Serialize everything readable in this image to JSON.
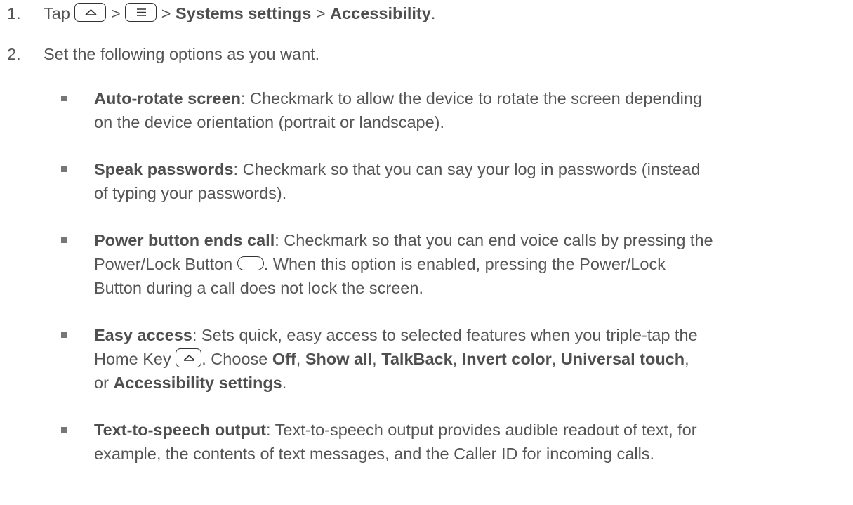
{
  "step1": {
    "num": "1.",
    "tap": "Tap",
    "sep1": ">",
    "sep2": ">",
    "path1": "Systems settings",
    "sep3": " > ",
    "path2": "Accessibility",
    "end": "."
  },
  "step2": {
    "num": "2.",
    "text": "Set the following options as you want."
  },
  "options": [
    {
      "title": "Auto-rotate screen",
      "lines": [
        ": Checkmark to allow the device to rotate the screen depending",
        "on the device orientation (portrait or landscape)."
      ]
    },
    {
      "title": "Speak passwords",
      "lines": [
        ": Checkmark so that you can say your log in passwords (instead",
        "of typing your passwords)."
      ]
    },
    {
      "title": "Power button ends call",
      "line1": ": Checkmark so that you can end voice calls by pressing the",
      "line2a": "Power/Lock Button",
      "line2b": ". When this option is enabled, pressing the Power/Lock",
      "line3": "Button during a call does not lock the screen."
    },
    {
      "title": "Easy access",
      "line1": ": Sets quick, easy access to selected features when you triple-tap the",
      "line2a": "Home Key",
      "line2b": ". Choose ",
      "choices": [
        "Off",
        "Show all",
        "TalkBack",
        "Invert color",
        "Universal touch"
      ],
      "comma": ", ",
      "line3a": "or ",
      "line3b": "Accessibility settings",
      "line3c": "."
    },
    {
      "title": "Text-to-speech output",
      "lines": [
        ": Text-to-speech output provides audible readout of text, for",
        "example, the contents of text messages, and the Caller ID for incoming calls."
      ]
    }
  ],
  "icons": {
    "home": "home-key-icon",
    "menu": "menu-key-icon",
    "power": "power-lock-button-icon"
  }
}
